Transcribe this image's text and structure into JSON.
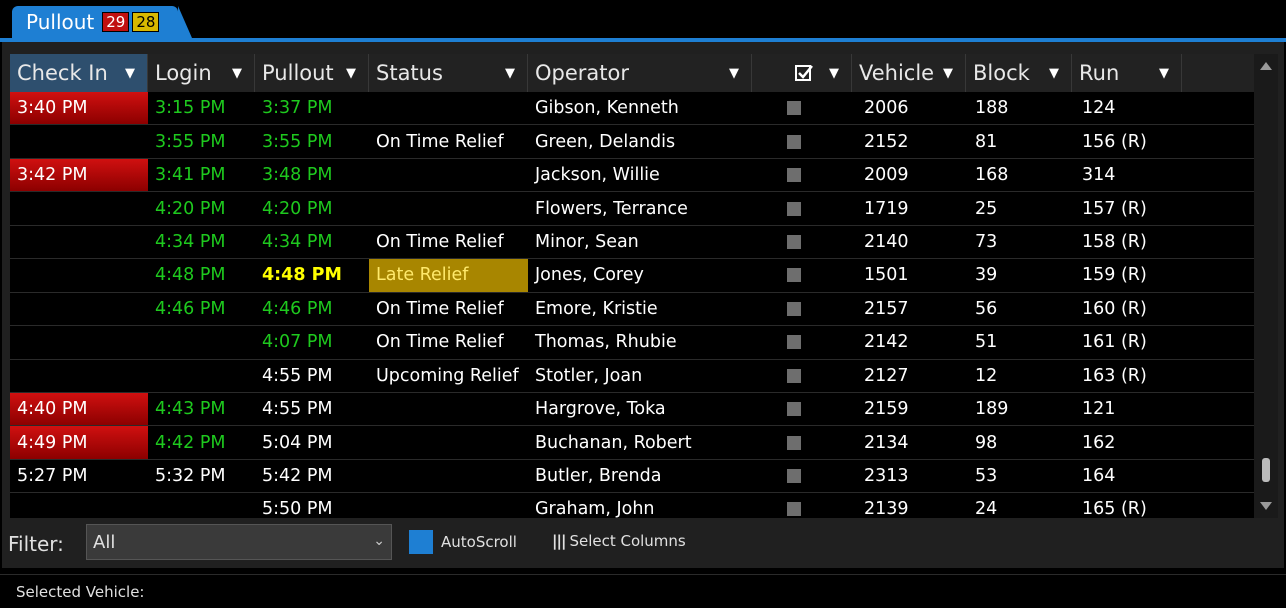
{
  "tab": {
    "label": "Pullout",
    "badge_red": "29",
    "badge_yellow": "28"
  },
  "columns": {
    "check_in": "Check In",
    "login": "Login",
    "pullout": "Pullout",
    "status": "Status",
    "operator": "Operator",
    "vehicle": "Vehicle",
    "block": "Block",
    "run": "Run"
  },
  "rows": [
    {
      "check_in": "3:40 PM",
      "login": "3:15 PM",
      "pullout": "3:37 PM",
      "status": "",
      "operator": "Gibson, Kenneth",
      "vehicle": "2006",
      "block": "188",
      "run": "124"
    },
    {
      "check_in": "",
      "login": "3:55 PM",
      "pullout": "3:55 PM",
      "status": "On Time Relief",
      "operator": "Green, Delandis",
      "vehicle": "2152",
      "block": "81",
      "run": "156 (R)"
    },
    {
      "check_in": "3:42 PM",
      "login": "3:41 PM",
      "pullout": "3:48 PM",
      "status": "",
      "operator": "Jackson, Willie",
      "vehicle": "2009",
      "block": "168",
      "run": "314"
    },
    {
      "check_in": "",
      "login": "4:20 PM",
      "pullout": "4:20 PM",
      "status": "",
      "operator": "Flowers, Terrance",
      "vehicle": "1719",
      "block": "25",
      "run": "157 (R)"
    },
    {
      "check_in": "",
      "login": "4:34 PM",
      "pullout": "4:34 PM",
      "status": "On Time Relief",
      "operator": "Minor, Sean",
      "vehicle": "2140",
      "block": "73",
      "run": "158 (R)"
    },
    {
      "check_in": "",
      "login": "4:48 PM",
      "pullout": "4:48 PM",
      "status": "Late Relief",
      "operator": "Jones, Corey",
      "vehicle": "1501",
      "block": "39",
      "run": "159 (R)"
    },
    {
      "check_in": "",
      "login": "4:46 PM",
      "pullout": "4:46 PM",
      "status": "On Time Relief",
      "operator": "Emore, Kristie",
      "vehicle": "2157",
      "block": "56",
      "run": "160 (R)"
    },
    {
      "check_in": "",
      "login": "",
      "pullout": "4:07 PM",
      "status": "On Time Relief",
      "operator": "Thomas, Rhubie",
      "vehicle": "2142",
      "block": "51",
      "run": "161 (R)"
    },
    {
      "check_in": "",
      "login": "",
      "pullout": "4:55 PM",
      "status": "Upcoming Relief",
      "operator": "Stotler, Joan",
      "vehicle": "2127",
      "block": "12",
      "run": "163 (R)"
    },
    {
      "check_in": "4:40 PM",
      "login": "4:43 PM",
      "pullout": "4:55 PM",
      "status": "",
      "operator": "Hargrove, Toka",
      "vehicle": "2159",
      "block": "189",
      "run": "121"
    },
    {
      "check_in": "4:49 PM",
      "login": "4:42 PM",
      "pullout": "5:04 PM",
      "status": "",
      "operator": "Buchanan, Robert",
      "vehicle": "2134",
      "block": "98",
      "run": "162"
    },
    {
      "check_in": "5:27 PM",
      "login": "5:32 PM",
      "pullout": "5:42 PM",
      "status": "",
      "operator": "Butler, Brenda",
      "vehicle": "2313",
      "block": "53",
      "run": "164"
    },
    {
      "check_in": "",
      "login": "",
      "pullout": "5:50 PM",
      "status": "",
      "operator": "Graham, John",
      "vehicle": "2139",
      "block": "24",
      "run": "165 (R)"
    }
  ],
  "filter": {
    "label": "Filter:",
    "value": "All"
  },
  "autoscroll": {
    "label": "AutoScroll"
  },
  "select_columns": {
    "label": "Select Columns"
  },
  "status_bar": {
    "label": "Selected Vehicle:"
  },
  "colors": {
    "accent": "#1e7fd3",
    "late_red": "#c01010",
    "late_yellow": "#a88600",
    "on_time_green": "#1ec91e"
  }
}
